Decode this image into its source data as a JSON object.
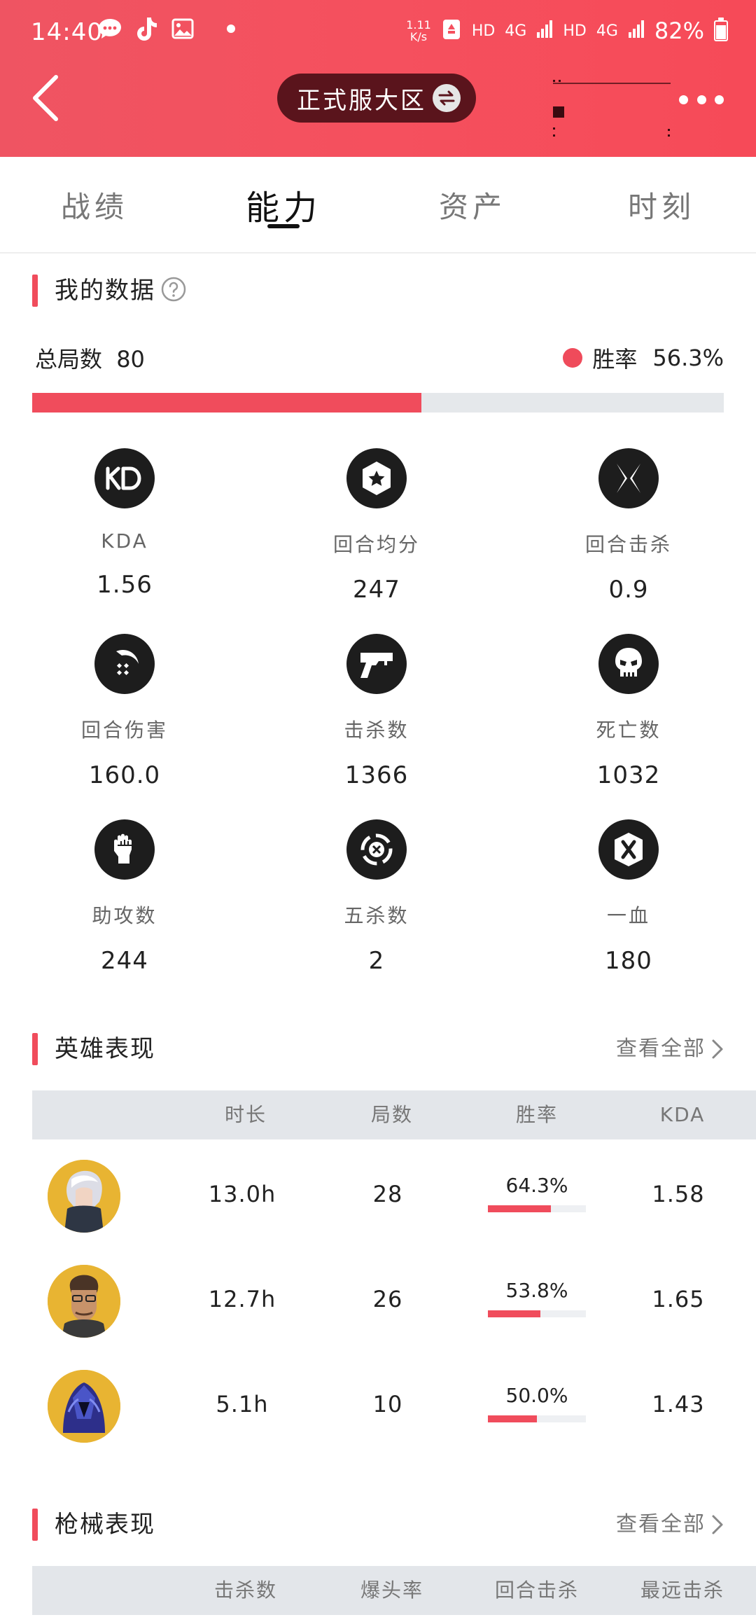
{
  "status_bar": {
    "time": "14:40",
    "net_speed_value": "1.11",
    "net_speed_unit": "K/s",
    "hd1": "HD",
    "net1": "4G",
    "hd2": "HD",
    "net2": "4G",
    "battery": "82%"
  },
  "header": {
    "region": "正式服大区",
    "accent_color": "#f5505e"
  },
  "tabs": [
    {
      "label": "战绩",
      "active": false
    },
    {
      "label": "能力",
      "active": true
    },
    {
      "label": "资产",
      "active": false
    },
    {
      "label": "时刻",
      "active": false
    }
  ],
  "my_data": {
    "title": "我的数据",
    "total_label": "总局数",
    "total_value": "80",
    "win_label": "胜率",
    "win_value": "56.3%",
    "win_fraction": 0.563,
    "stats": [
      {
        "icon": "kd-icon",
        "label": "KDA",
        "value": "1.56"
      },
      {
        "icon": "star-badge-icon",
        "label": "回合均分",
        "value": "247"
      },
      {
        "icon": "crossed-blades-icon",
        "label": "回合击杀",
        "value": "0.9"
      },
      {
        "icon": "damage-icon",
        "label": "回合伤害",
        "value": "160.0"
      },
      {
        "icon": "gun-icon",
        "label": "击杀数",
        "value": "1366"
      },
      {
        "icon": "skull-icon",
        "label": "死亡数",
        "value": "1032"
      },
      {
        "icon": "fist-icon",
        "label": "助攻数",
        "value": "244"
      },
      {
        "icon": "ace-icon",
        "label": "五杀数",
        "value": "2"
      },
      {
        "icon": "first-blood-icon",
        "label": "一血",
        "value": "180"
      }
    ]
  },
  "hero_performance": {
    "title": "英雄表现",
    "see_all": "查看全部",
    "columns": [
      "时长",
      "局数",
      "胜率",
      "KDA"
    ],
    "rows": [
      {
        "avatar": "hero-avatar-1",
        "duration": "13.0h",
        "matches": "28",
        "win_rate": "64.3%",
        "win_fraction": 0.643,
        "kda": "1.58"
      },
      {
        "avatar": "hero-avatar-2",
        "duration": "12.7h",
        "matches": "26",
        "win_rate": "53.8%",
        "win_fraction": 0.538,
        "kda": "1.65"
      },
      {
        "avatar": "hero-avatar-3",
        "duration": "5.1h",
        "matches": "10",
        "win_rate": "50.0%",
        "win_fraction": 0.5,
        "kda": "1.43"
      }
    ]
  },
  "weapon_performance": {
    "title": "枪械表现",
    "see_all": "查看全部",
    "columns": [
      "击杀数",
      "爆头率",
      "回合击杀",
      "最远击杀"
    ]
  }
}
